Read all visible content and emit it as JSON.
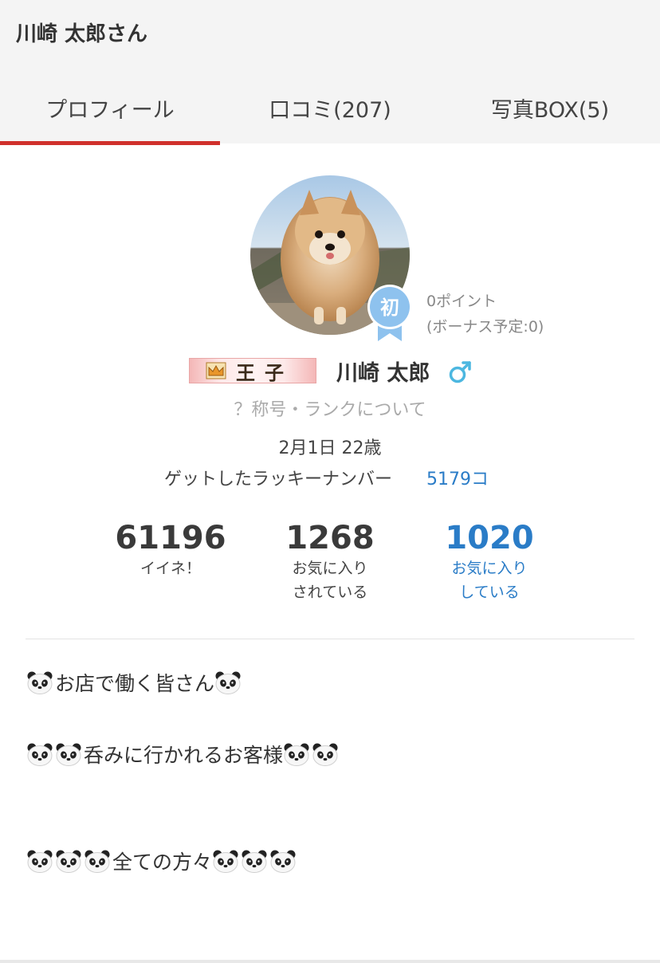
{
  "header": {
    "title": "川崎 太郎さん",
    "tabs": [
      {
        "label": "プロフィール",
        "active": true
      },
      {
        "label": "口コミ(207)",
        "active": false
      },
      {
        "label": "写真BOX(5)",
        "active": false
      }
    ]
  },
  "profile": {
    "badge_char": "初",
    "points": "0ポイント",
    "bonus": "(ボーナス予定:0)",
    "rank_title": "王子",
    "name": "川崎 太郎",
    "gender_symbol": "♂",
    "rank_help": "？称号・ランクについて",
    "birthday_age": "2月1日 22歳",
    "lucky_label": "ゲットしたラッキーナンバー",
    "lucky_value": "5179コ"
  },
  "stats": [
    {
      "value": "61196",
      "label": "イイネ！"
    },
    {
      "value": "1268",
      "label": "お気に入り\nされている"
    },
    {
      "value": "1020",
      "label": "お気に入り\nしている"
    }
  ],
  "bio": {
    "line1": "お店で働く皆さん",
    "line2": "呑みに行かれるお客様",
    "line3": "全ての方々"
  },
  "colors": {
    "accent": "#d0302c",
    "link": "#2a7cc7",
    "badge": "#8ec2ee",
    "gender": "#4cb7e0"
  }
}
